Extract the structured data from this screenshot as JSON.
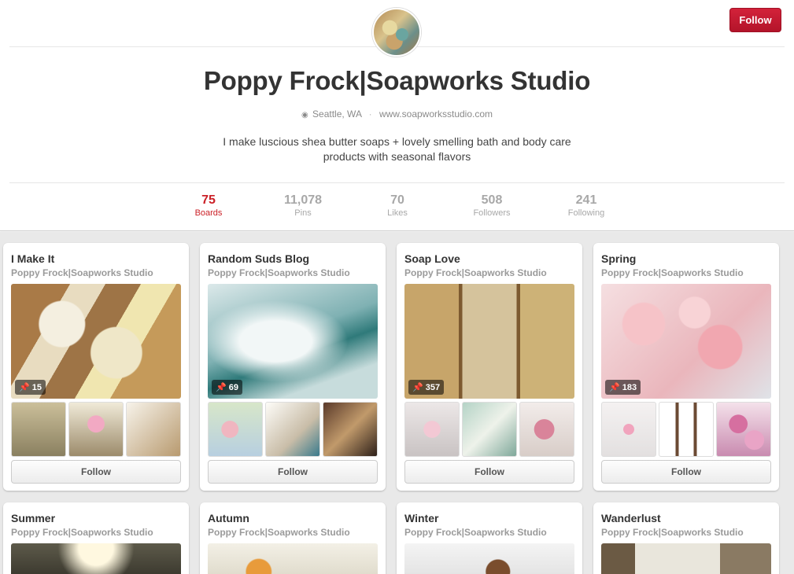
{
  "header": {
    "follow_label": "Follow",
    "name": "Poppy Frock|Soapworks Studio",
    "location": "Seattle, WA",
    "website": "www.soapworksstudio.com",
    "about": "I make luscious shea butter soaps + lovely smelling bath and body care products with seasonal flavors"
  },
  "stats": [
    {
      "num": "75",
      "label": "Boards",
      "active": true
    },
    {
      "num": "11,078",
      "label": "Pins"
    },
    {
      "num": "70",
      "label": "Likes"
    },
    {
      "num": "508",
      "label": "Followers"
    },
    {
      "num": "241",
      "label": "Following"
    }
  ],
  "boards": [
    {
      "title": "I Make It",
      "owner": "Poppy Frock|Soapworks Studio",
      "pins": "15",
      "follow": "Follow"
    },
    {
      "title": "Random Suds Blog",
      "owner": "Poppy Frock|Soapworks Studio",
      "pins": "69",
      "follow": "Follow"
    },
    {
      "title": "Soap Love",
      "owner": "Poppy Frock|Soapworks Studio",
      "pins": "357",
      "follow": "Follow"
    },
    {
      "title": "Spring",
      "owner": "Poppy Frock|Soapworks Studio",
      "pins": "183",
      "follow": "Follow"
    },
    {
      "title": "Summer",
      "owner": "Poppy Frock|Soapworks Studio"
    },
    {
      "title": "Autumn",
      "owner": "Poppy Frock|Soapworks Studio"
    },
    {
      "title": "Winter",
      "owner": "Poppy Frock|Soapworks Studio"
    },
    {
      "title": "Wanderlust",
      "owner": "Poppy Frock|Soapworks Studio"
    }
  ],
  "icons": {
    "location": "location-icon",
    "pin": "pin-icon"
  },
  "colors": {
    "accent": "#cb2027",
    "follow_button": "#c8192f"
  }
}
